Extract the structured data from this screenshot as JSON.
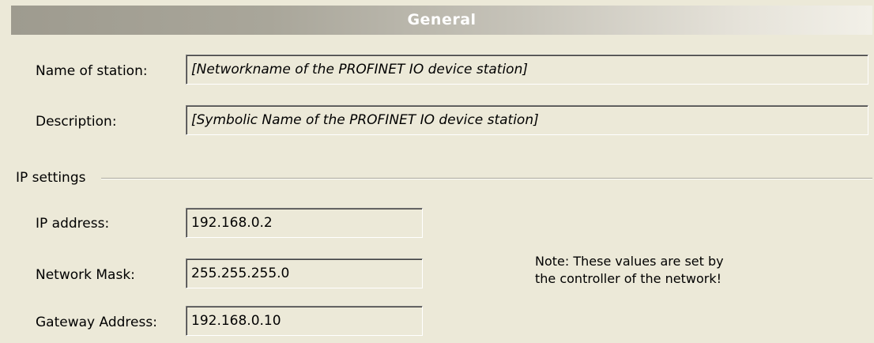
{
  "header": {
    "title": "General"
  },
  "station": {
    "name_label": "Name of station:",
    "name_value": "[Networkname of the PROFINET IO device station]",
    "description_label": "Description:",
    "description_value": "[Symbolic Name of the PROFINET IO device station]"
  },
  "ip_settings": {
    "group_label": "IP settings",
    "ip_label": "IP address:",
    "ip_value": "192.168.0.2",
    "mask_label": "Network Mask:",
    "mask_value": "255.255.255.0",
    "gateway_label": "Gateway Address:",
    "gateway_value": "192.168.0.10",
    "note_line1": "Note: These values are set by",
    "note_line2": "the controller of the network!"
  }
}
